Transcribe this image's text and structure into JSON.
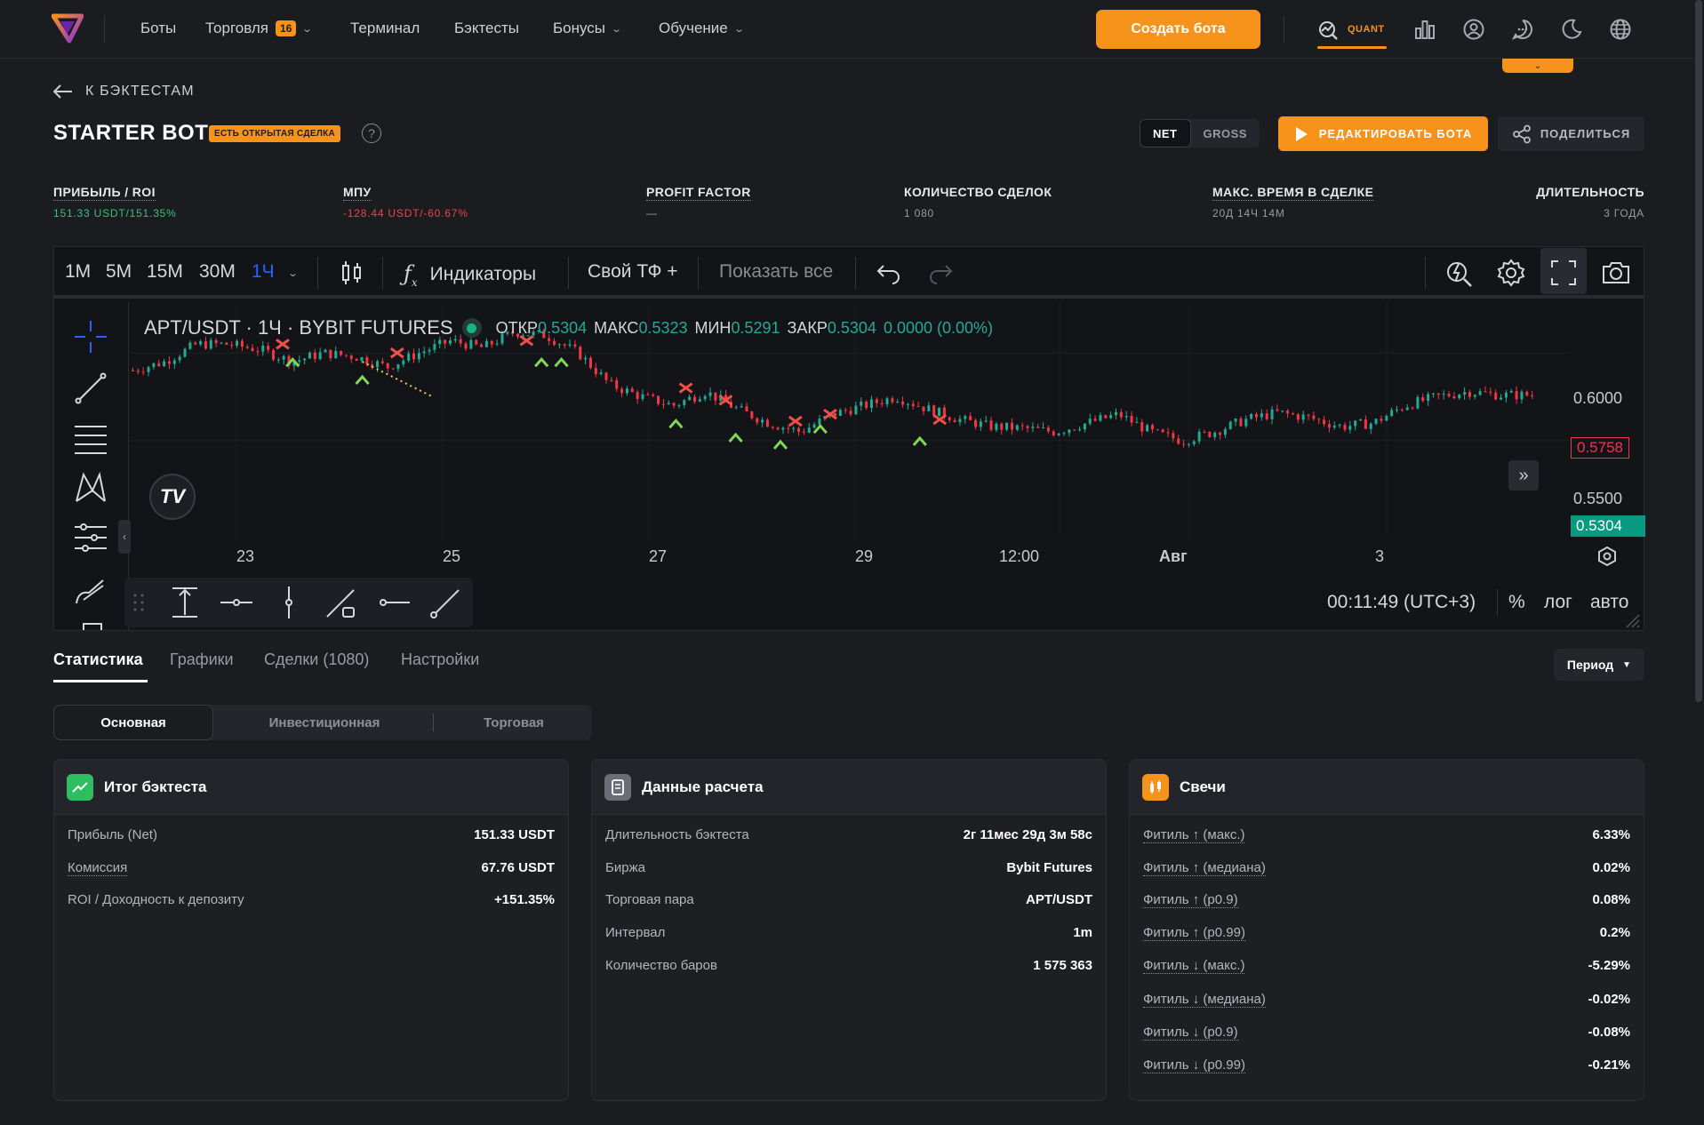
{
  "nav": {
    "items": [
      {
        "label": "Боты"
      },
      {
        "label": "Торговля",
        "badge": "16"
      },
      {
        "label": "Терминал"
      },
      {
        "label": "Бэктесты"
      },
      {
        "label": "Бонусы"
      },
      {
        "label": "Обучение"
      }
    ],
    "create_bot": "Создать бота",
    "quant_label": "QUANT",
    "accent": "#f7931a"
  },
  "header": {
    "back_label": "К БЭКТЕСТАМ",
    "title": "STARTER BOT",
    "open_badge": "ЕСТЬ ОТКРЫТАЯ СДЕЛКА",
    "help": "?",
    "net": "NET",
    "gross": "GROSS",
    "edit_btn": "РЕДАКТИРОВАТЬ БОТА",
    "share_btn": "ПОДЕЛИТЬСЯ"
  },
  "metrics": [
    {
      "label": "ПРИБЫЛЬ / ROI",
      "value": "151.33 USDT/151.35%",
      "tone": "green"
    },
    {
      "label": "МПУ",
      "value": "-128.44 USDT/-60.67%",
      "tone": "red"
    },
    {
      "label": "PROFIT FACTOR",
      "value": "—",
      "tone": "grey"
    },
    {
      "label": "КОЛИЧЕСТВО СДЕЛОК",
      "value": "1 080",
      "tone": "grey"
    },
    {
      "label": "МАКС. ВРЕМЯ В СДЕЛКЕ",
      "value": "20Д 14Ч 14М",
      "tone": "grey"
    },
    {
      "label": "ДЛИТЕЛЬНОСТЬ",
      "value": "3 ГОДА",
      "tone": "grey"
    }
  ],
  "chart_toolbar": {
    "intervals": [
      "1M",
      "5M",
      "15M",
      "30M",
      "1Ч"
    ],
    "active_interval": "1Ч",
    "indicators": "Индикаторы",
    "custom_tf": "Свой ТФ +",
    "show_all": "Показать все"
  },
  "chart": {
    "symbol": "APT/USDT · 1Ч · BYBIT FUTURES",
    "ohlc": {
      "open_label": "ОТКР",
      "open": "0.5304",
      "high_label": "МАКС",
      "high": "0.5323",
      "low_label": "МИН",
      "low": "0.5291",
      "close_label": "ЗАКР",
      "close": "0.5304",
      "change": "0.0000 (0.00%)"
    },
    "price_labels": [
      "0.6000",
      "0.5500"
    ],
    "tag_marker": "0.5758",
    "tag_last": "0.5304",
    "time_labels": [
      "23",
      "25",
      "27",
      "29",
      "12:00",
      "Авг",
      "3"
    ],
    "timestamp": "00:11:49 (UTC+3)",
    "scale_pct": "%",
    "scale_log": "лог",
    "scale_auto": "авто",
    "up_color": "#22ab94",
    "down_color": "#f23645"
  },
  "chart_data": {
    "type": "candlestick",
    "x_labels": [
      "23",
      "25",
      "27",
      "29",
      "12:00",
      "Авг",
      "3"
    ],
    "y_ticks": [
      0.6,
      0.55
    ],
    "last_price": 0.5304,
    "marker_price": 0.5758,
    "close_path": [
      0.59,
      0.595,
      0.605,
      0.605,
      0.602,
      0.595,
      0.6,
      0.598,
      0.592,
      0.6,
      0.607,
      0.603,
      0.612,
      0.61,
      0.6,
      0.582,
      0.575,
      0.57,
      0.578,
      0.568,
      0.56,
      0.555,
      0.565,
      0.57,
      0.575,
      0.568,
      0.562,
      0.558,
      0.557,
      0.555,
      0.56,
      0.565,
      0.555,
      0.55,
      0.555,
      0.562,
      0.566,
      0.563,
      0.558,
      0.56,
      0.57,
      0.575,
      0.578,
      0.576,
      0.576
    ]
  },
  "tabs": [
    "Статистика",
    "Графики",
    "Сделки (1080)",
    "Настройки"
  ],
  "period_label": "Период",
  "subtabs": [
    "Основная",
    "Инвестиционная",
    "Торговая"
  ],
  "cards": {
    "summary": {
      "title": "Итог бэктеста",
      "rows": [
        {
          "k": "Прибыль (Net)",
          "v": "151.33 USDT"
        },
        {
          "k": "Комиссия",
          "v": "67.76 USDT"
        },
        {
          "k": "ROI / Доходность к депозиту",
          "v": "+151.35%"
        }
      ]
    },
    "calc": {
      "title": "Данные расчета",
      "rows": [
        {
          "k": "Длительность бэктеста",
          "v": "2г 11мес 29д 3м 58с"
        },
        {
          "k": "Биржа",
          "v": "Bybit Futures"
        },
        {
          "k": "Торговая пара",
          "v": "APT/USDT"
        },
        {
          "k": "Интервал",
          "v": "1m"
        },
        {
          "k": "Количество баров",
          "v": "1 575 363"
        }
      ]
    },
    "candles": {
      "title": "Свечи",
      "rows": [
        {
          "k": "Фитиль ↑ (макс.)",
          "v": "6.33%"
        },
        {
          "k": "Фитиль ↑ (медиана)",
          "v": "0.02%"
        },
        {
          "k": "Фитиль ↑ (p0.9)",
          "v": "0.08%"
        },
        {
          "k": "Фитиль ↑ (p0.99)",
          "v": "0.2%"
        },
        {
          "k": "Фитиль ↓ (макс.)",
          "v": "-5.29%"
        },
        {
          "k": "Фитиль ↓ (медиана)",
          "v": "-0.02%"
        },
        {
          "k": "Фитиль ↓ (p0.9)",
          "v": "-0.08%"
        },
        {
          "k": "Фитиль ↓ (p0.99)",
          "v": "-0.21%"
        }
      ]
    }
  }
}
